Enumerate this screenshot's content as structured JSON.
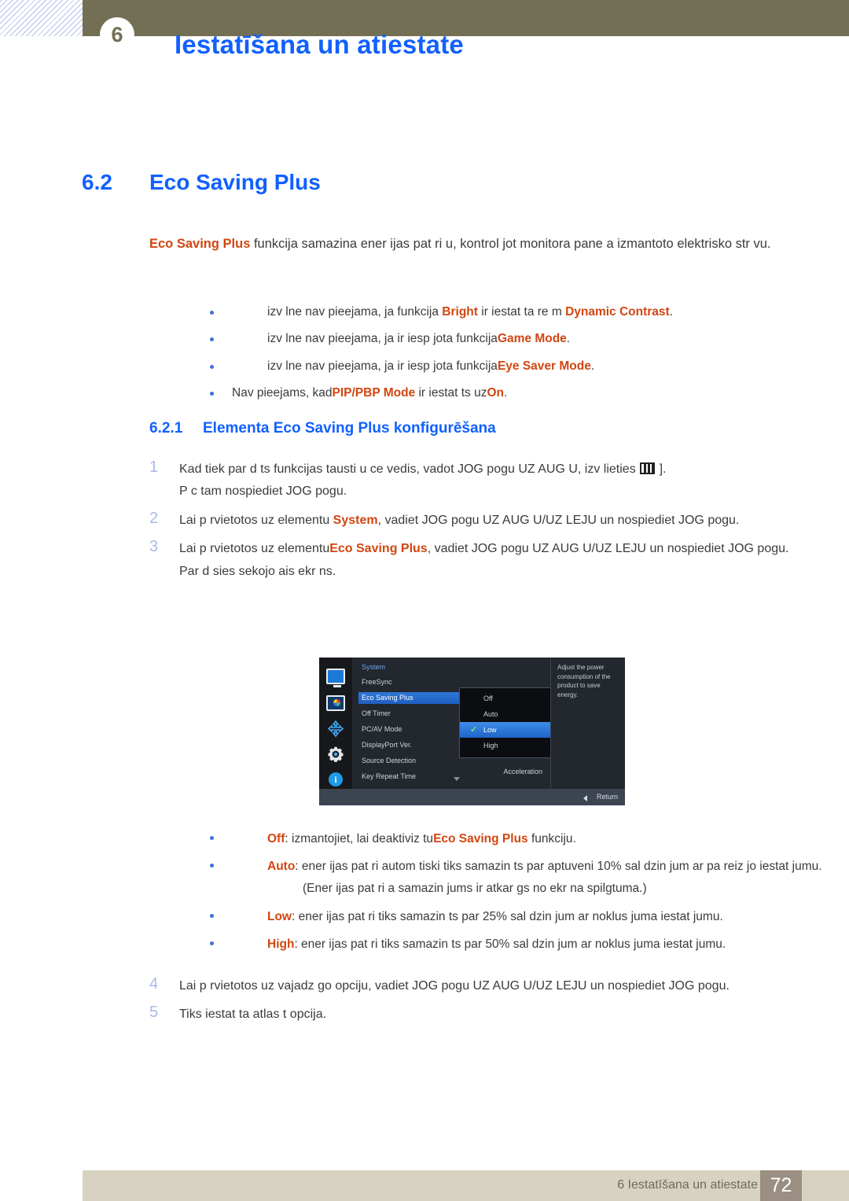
{
  "header": {
    "chapter_number": "6",
    "title": "Iestatīšana un atiestate"
  },
  "section": {
    "number": "6.2",
    "title": "Eco Saving Plus"
  },
  "intro": {
    "term": "Eco Saving Plus",
    "rest": " funkcija samazina ener ijas pat ri u, kontrol jot monitora pane a izmantoto elektrisko str vu."
  },
  "notes": [
    {
      "pre": "izv lne nav pieejama, ja funkcija ",
      "term1": "Bright",
      "mid": " ir iestat ta re m ",
      "term2": "Dynamic Contrast",
      "post": ".",
      "indent": true
    },
    {
      "pre": "izv lne nav pieejama, ja ir iesp jota funkcija",
      "term1": "Game Mode",
      "mid": "",
      "term2": "",
      "post": ".",
      "indent": true
    },
    {
      "pre": "izv lne nav pieejama, ja ir iesp jota funkcija",
      "term1": "Eye Saver Mode",
      "mid": "",
      "term2": "",
      "post": ".",
      "indent": true
    },
    {
      "pre": "Nav pieejams, kad",
      "term1": "PIP/PBP Mode",
      "mid": " ir iestat ts uz",
      "term2": "On",
      "post": ".",
      "indent": false
    }
  ],
  "subsection": {
    "number": "6.2.1",
    "title": "Elementa Eco Saving Plus konfigurēšana"
  },
  "steps": [
    {
      "num": "1",
      "line1_a": "Kad tiek par d ts funkcijas tausti u ce vedis, vadot JOG pogu UZ AUG U, izv lieties ",
      "icon": "menu-bars-icon",
      "line1_b": " ].",
      "line2": "P c tam nospiediet JOG pogu."
    },
    {
      "num": "2",
      "pre": "Lai p rvietotos uz elementu ",
      "term": "System",
      "post": ", vadiet JOG pogu UZ AUG U/UZ LEJU un nospiediet JOG pogu."
    },
    {
      "num": "3",
      "pre": "Lai p rvietotos uz elementu",
      "term": "Eco Saving Plus",
      "post": ", vadiet JOG pogu UZ AUG U/UZ LEJU un nospiediet JOG pogu.",
      "extra": "Par d sies sekojo ais ekr ns."
    }
  ],
  "osd": {
    "category": "System",
    "menu_items": [
      {
        "label": "FreeSync",
        "selected": false
      },
      {
        "label": "Eco Saving Plus",
        "selected": true
      },
      {
        "label": "Off Timer",
        "selected": false
      },
      {
        "label": "PC/AV Mode",
        "selected": false
      },
      {
        "label": "DisplayPort Ver.",
        "selected": false
      },
      {
        "label": "Source Detection",
        "selected": false
      },
      {
        "label": "Key Repeat Time",
        "selected": false
      }
    ],
    "acceleration_label": "Acceleration",
    "submenu": [
      {
        "label": "Off",
        "selected": false,
        "checked": false
      },
      {
        "label": "Auto",
        "selected": false,
        "checked": false
      },
      {
        "label": "Low",
        "selected": true,
        "checked": true
      },
      {
        "label": "High",
        "selected": false,
        "checked": false
      }
    ],
    "help_text": "Adjust the power consumption of the product to save energy.",
    "return_label": "Return",
    "rail_icons": [
      "monitor-icon",
      "picture-color-icon",
      "pip-arrows-icon",
      "gear-icon",
      "info-icon"
    ],
    "colors": {
      "highlight": "#2e77d6",
      "category_text": "#6ea8e8",
      "check": "#7ee06a",
      "panel": "#23272e",
      "rail": "#16181c",
      "frame": "#3c4450"
    }
  },
  "options": [
    {
      "term": "Off",
      "pre": ": izmantojiet, lai deaktiviz tu",
      "term2": "Eco Saving Plus",
      "post": " funkciju."
    },
    {
      "term": "Auto",
      "pre": ": ener ijas pat ri  autom tiski tiks samazin ts par aptuveni 10% sal dzin jum  ar pa reiz jo iestat jumu.",
      "term2": "",
      "post": "",
      "note": "(Ener ijas pat ri a samazin jums ir atkar gs no ekr na spilgtuma.)"
    },
    {
      "term": "Low",
      "pre": ": ener ijas pat ri  tiks samazin ts par 25% sal dzin jum  ar noklus juma iestat jumu.",
      "term2": "",
      "post": ""
    },
    {
      "term": "High",
      "pre": ": ener ijas pat ri  tiks samazin ts par 50% sal dzin jum  ar noklus juma iestat jumu.",
      "term2": "",
      "post": ""
    }
  ],
  "steps2": [
    {
      "num": "4",
      "text": "Lai p rvietotos uz vajadz go opciju, vadiet JOG pogu UZ AUG U/UZ LEJU un nospiediet JOG pogu."
    },
    {
      "num": "5",
      "text": "Tiks iestat ta atlas t  opcija."
    }
  ],
  "footer": {
    "text": "6 Iestatīšana un atiestate",
    "page": "72"
  }
}
